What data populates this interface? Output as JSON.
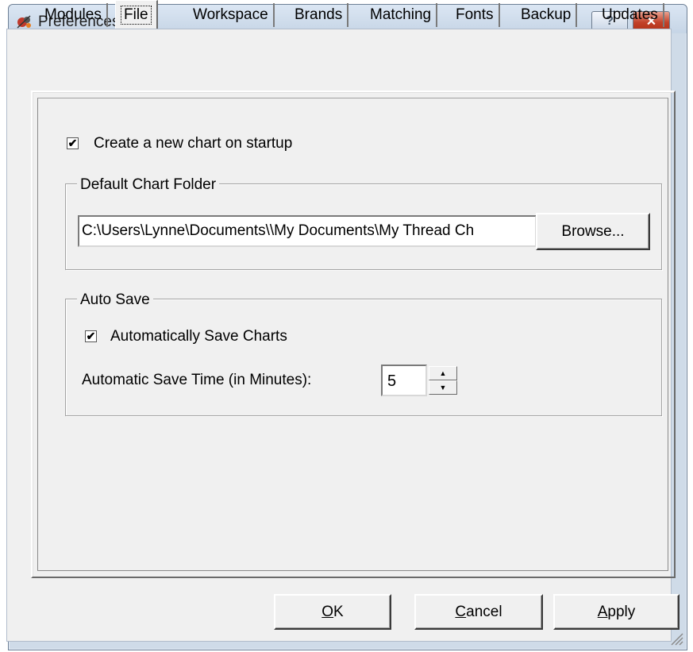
{
  "window": {
    "title": "Preferences",
    "help_glyph": "?",
    "close_glyph": "✕",
    "app_icon": "app-logo-icon"
  },
  "tabs": [
    {
      "label": "Modules",
      "active": false
    },
    {
      "label": "File",
      "active": true
    },
    {
      "label": "Workspace",
      "active": false
    },
    {
      "label": "Brands",
      "active": false
    },
    {
      "label": "Matching",
      "active": false
    },
    {
      "label": "Fonts",
      "active": false
    },
    {
      "label": "Backup",
      "active": false
    },
    {
      "label": "Updates",
      "active": false
    }
  ],
  "file_tab": {
    "create_new_chart": {
      "label": "Create a new chart on startup",
      "checked": true
    },
    "default_chart_folder": {
      "legend": "Default Chart Folder",
      "path": "C:\\Users\\Lynne\\Documents\\\\My Documents\\My Thread Ch",
      "browse_label": "Browse..."
    },
    "auto_save": {
      "legend": "Auto Save",
      "auto_save_charts": {
        "label": "Automatically Save Charts",
        "checked": true
      },
      "save_time_label": "Automatic Save Time (in Minutes):",
      "save_time_value": "5"
    }
  },
  "buttons": {
    "ok": {
      "prefix": "",
      "mnemonic": "O",
      "rest": "K"
    },
    "cancel": {
      "prefix": "",
      "mnemonic": "C",
      "rest": "ancel"
    },
    "apply": {
      "prefix": "",
      "mnemonic": "A",
      "rest": "pply"
    }
  }
}
